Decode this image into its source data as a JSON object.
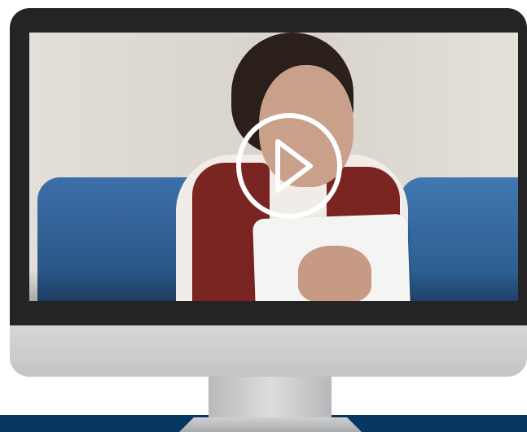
{
  "video": {
    "play_icon": "play-icon",
    "state": "paused"
  },
  "colors": {
    "bezel": "#242424",
    "chin": "#c8c9cb",
    "footer_bar": "#073864",
    "play_ring": "#ffffff"
  }
}
